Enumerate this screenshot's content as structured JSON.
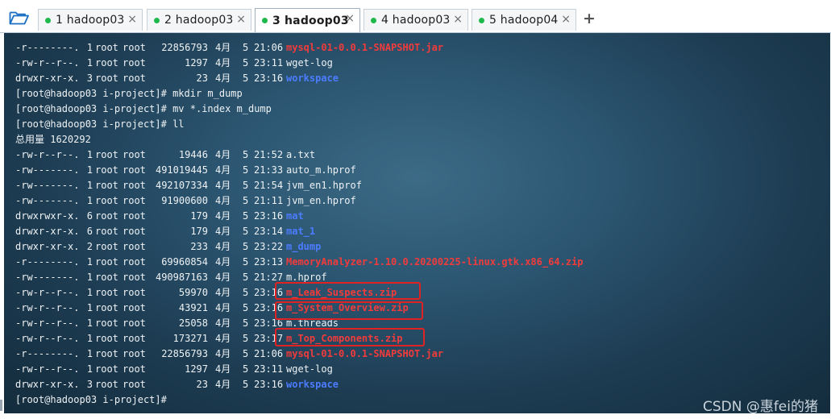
{
  "tabs": [
    {
      "label": "1 hadoop03",
      "active": false,
      "dot": "#1fb84a"
    },
    {
      "label": "2 hadoop03",
      "active": false,
      "dot": "#1fb84a"
    },
    {
      "label": "3 hadoop03",
      "active": true,
      "dot": "#1fb84a"
    },
    {
      "label": "4 hadoop03",
      "active": false,
      "dot": "#1fb84a"
    },
    {
      "label": "5 hadoop04",
      "active": false,
      "dot": "#1fb84a"
    }
  ],
  "tab_close_glyph": "×",
  "add_tab_glyph": "+",
  "colors": {
    "file_red": "#f23b3b",
    "dir_blue": "#4c7cff",
    "highlight": "#e02222"
  },
  "terminal": {
    "lines": [
      {
        "kind": "ls",
        "perm": "-r--------.",
        "links": "1",
        "owner": "root",
        "group": "root",
        "size": "22856793",
        "month": "4月",
        "day": "5",
        "time": "21:06",
        "name": "mysql-01-0.0.1-SNAPSHOT.jar",
        "style": "red"
      },
      {
        "kind": "ls",
        "perm": "-rw-r--r--.",
        "links": "1",
        "owner": "root",
        "group": "root",
        "size": "1297",
        "month": "4月",
        "day": "5",
        "time": "23:11",
        "name": "wget-log",
        "style": ""
      },
      {
        "kind": "ls",
        "perm": "drwxr-xr-x.",
        "links": "3",
        "owner": "root",
        "group": "root",
        "size": "23",
        "month": "4月",
        "day": "5",
        "time": "23:16",
        "name": "workspace",
        "style": "blue"
      },
      {
        "kind": "text",
        "text": "[root@hadoop03 i-project]# mkdir m_dump"
      },
      {
        "kind": "text",
        "text": "[root@hadoop03 i-project]# mv *.index m_dump"
      },
      {
        "kind": "text",
        "text": "[root@hadoop03 i-project]# ll"
      },
      {
        "kind": "text",
        "text": "总用量 1620292"
      },
      {
        "kind": "ls",
        "perm": "-rw-r--r--.",
        "links": "1",
        "owner": "root",
        "group": "root",
        "size": "19446",
        "month": "4月",
        "day": "5",
        "time": "21:52",
        "name": "a.txt",
        "style": ""
      },
      {
        "kind": "ls",
        "perm": "-rw-------.",
        "links": "1",
        "owner": "root",
        "group": "root",
        "size": "491019445",
        "month": "4月",
        "day": "5",
        "time": "21:33",
        "name": "auto_m.hprof",
        "style": ""
      },
      {
        "kind": "ls",
        "perm": "-rw-------.",
        "links": "1",
        "owner": "root",
        "group": "root",
        "size": "492107334",
        "month": "4月",
        "day": "5",
        "time": "21:54",
        "name": "jvm_en1.hprof",
        "style": ""
      },
      {
        "kind": "ls",
        "perm": "-rw-------.",
        "links": "1",
        "owner": "root",
        "group": "root",
        "size": "91900600",
        "month": "4月",
        "day": "5",
        "time": "21:11",
        "name": "jvm_en.hprof",
        "style": ""
      },
      {
        "kind": "ls",
        "perm": "drwxrwxr-x.",
        "links": "6",
        "owner": "root",
        "group": "root",
        "size": "179",
        "month": "4月",
        "day": "5",
        "time": "23:16",
        "name": "mat",
        "style": "blue"
      },
      {
        "kind": "ls",
        "perm": "drwxr-xr-x.",
        "links": "6",
        "owner": "root",
        "group": "root",
        "size": "179",
        "month": "4月",
        "day": "5",
        "time": "23:14",
        "name": "mat_1",
        "style": "blue"
      },
      {
        "kind": "ls",
        "perm": "drwxr-xr-x.",
        "links": "2",
        "owner": "root",
        "group": "root",
        "size": "233",
        "month": "4月",
        "day": "5",
        "time": "23:22",
        "name": "m_dump",
        "style": "blue"
      },
      {
        "kind": "ls",
        "perm": "-r--------.",
        "links": "1",
        "owner": "root",
        "group": "root",
        "size": "69960854",
        "month": "4月",
        "day": "5",
        "time": "23:13",
        "name": "MemoryAnalyzer-1.10.0.20200225-linux.gtk.x86_64.zip",
        "style": "red"
      },
      {
        "kind": "ls",
        "perm": "-rw-------.",
        "links": "1",
        "owner": "root",
        "group": "root",
        "size": "490987163",
        "month": "4月",
        "day": "5",
        "time": "21:27",
        "name": "m.hprof",
        "style": ""
      },
      {
        "kind": "ls",
        "perm": "-rw-r--r--.",
        "links": "1",
        "owner": "root",
        "group": "root",
        "size": "59970",
        "month": "4月",
        "day": "5",
        "time": "23:16",
        "name": "m_Leak_Suspects.zip",
        "style": "red"
      },
      {
        "kind": "ls",
        "perm": "-rw-r--r--.",
        "links": "1",
        "owner": "root",
        "group": "root",
        "size": "43921",
        "month": "4月",
        "day": "5",
        "time": "23:16",
        "name": "m_System_Overview.zip",
        "style": "red"
      },
      {
        "kind": "ls",
        "perm": "-rw-r--r--.",
        "links": "1",
        "owner": "root",
        "group": "root",
        "size": "25058",
        "month": "4月",
        "day": "5",
        "time": "23:16",
        "name": "m.threads",
        "style": ""
      },
      {
        "kind": "ls",
        "perm": "-rw-r--r--.",
        "links": "1",
        "owner": "root",
        "group": "root",
        "size": "173271",
        "month": "4月",
        "day": "5",
        "time": "23:17",
        "name": "m_Top_Components.zip",
        "style": "red"
      },
      {
        "kind": "ls",
        "perm": "-r--------.",
        "links": "1",
        "owner": "root",
        "group": "root",
        "size": "22856793",
        "month": "4月",
        "day": "5",
        "time": "21:06",
        "name": "mysql-01-0.0.1-SNAPSHOT.jar",
        "style": "red"
      },
      {
        "kind": "ls",
        "perm": "-rw-r--r--.",
        "links": "1",
        "owner": "root",
        "group": "root",
        "size": "1297",
        "month": "4月",
        "day": "5",
        "time": "23:11",
        "name": "wget-log",
        "style": ""
      },
      {
        "kind": "ls",
        "perm": "drwxr-xr-x.",
        "links": "3",
        "owner": "root",
        "group": "root",
        "size": "23",
        "month": "4月",
        "day": "5",
        "time": "23:16",
        "name": "workspace",
        "style": "blue"
      },
      {
        "kind": "text",
        "text": "[root@hadoop03 i-project]#"
      }
    ]
  },
  "watermark": "CSDN @惠fei的猪"
}
